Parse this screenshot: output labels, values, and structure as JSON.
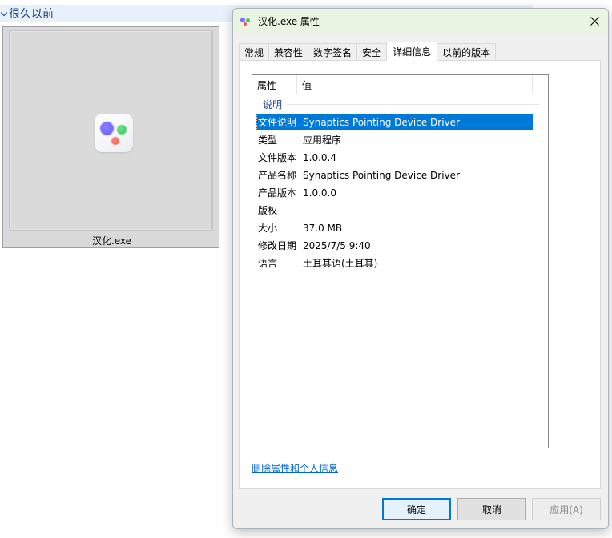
{
  "explorer": {
    "group_title": "很久以前",
    "file_name": "汉化.exe"
  },
  "dialog": {
    "title": "汉化.exe 属性",
    "tabs": [
      {
        "label": "常规"
      },
      {
        "label": "兼容性"
      },
      {
        "label": "数字签名"
      },
      {
        "label": "安全"
      },
      {
        "label": "详细信息",
        "active": true
      },
      {
        "label": "以前的版本"
      }
    ],
    "columns": {
      "property": "属性",
      "value": "值"
    },
    "section": "说明",
    "rows": [
      {
        "k": "文件说明",
        "v": "Synaptics Pointing Device Driver",
        "selected": true
      },
      {
        "k": "类型",
        "v": "应用程序"
      },
      {
        "k": "文件版本",
        "v": "1.0.0.4"
      },
      {
        "k": "产品名称",
        "v": "Synaptics Pointing Device Driver"
      },
      {
        "k": "产品版本",
        "v": "1.0.0.0"
      },
      {
        "k": "版权",
        "v": ""
      },
      {
        "k": "大小",
        "v": "37.0 MB"
      },
      {
        "k": "修改日期",
        "v": "2025/7/5 9:40"
      },
      {
        "k": "语言",
        "v": "土耳其语(土耳其)"
      }
    ],
    "remove_link": "删除属性和个人信息",
    "buttons": {
      "ok": "确定",
      "cancel": "取消",
      "apply": "应用(A)"
    }
  },
  "icons": {
    "app": "app-logo-icon",
    "close": "close-icon",
    "chevron": "chevron-down-icon"
  },
  "colors": {
    "selection": "#0078d7",
    "link": "#0066cc",
    "section": "#1e3f9a",
    "titlebar": "#eaf4e3"
  }
}
